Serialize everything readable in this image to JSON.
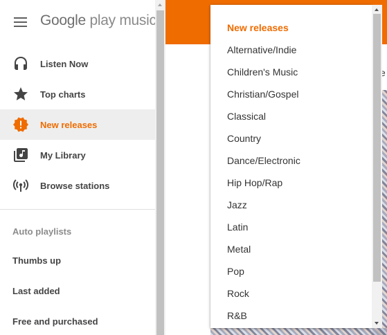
{
  "app": {
    "brand_google": "Google",
    "brand_rest": "play music",
    "accent_color": "#ef6c00"
  },
  "sidebar": {
    "items": [
      {
        "label": "Listen Now",
        "icon": "headphones-icon"
      },
      {
        "label": "Top charts",
        "icon": "star-icon"
      },
      {
        "label": "New releases",
        "icon": "new-releases-badge-icon",
        "active": true
      },
      {
        "label": "My Library",
        "icon": "library-music-icon"
      },
      {
        "label": "Browse stations",
        "icon": "radio-tower-icon"
      }
    ],
    "playlists_heading": "Auto playlists",
    "playlists": [
      "Thumbs up",
      "Last added",
      "Free and purchased"
    ]
  },
  "main": {
    "edge_text": "e"
  },
  "genre_dropdown": {
    "selected": "New releases",
    "options": [
      "New releases",
      "Alternative/Indie",
      "Children's Music",
      "Christian/Gospel",
      "Classical",
      "Country",
      "Dance/Electronic",
      "Hip Hop/Rap",
      "Jazz",
      "Latin",
      "Metal",
      "Pop",
      "Rock",
      "R&B"
    ]
  }
}
